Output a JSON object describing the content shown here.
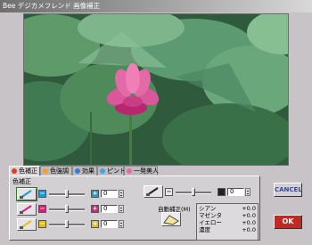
{
  "window": {
    "title": "Bee デジカメフレンド 画像補正"
  },
  "tabs": [
    {
      "label": "色補正",
      "color": "#e23b2a"
    },
    {
      "label": "色強調",
      "color": "#f0a030"
    },
    {
      "label": "効果",
      "color": "#3a7bd5"
    },
    {
      "label": "ピント",
      "color": "#4aa0e0"
    },
    {
      "label": "一発美人",
      "color": "#e86aa0"
    }
  ],
  "panel": {
    "section_label": "色補正",
    "sliders": [
      {
        "name": "cyan",
        "minus": "−",
        "plus": "+",
        "value": "0",
        "minus_color": "#1e9ad6",
        "plus_color": "#1e9ad6"
      },
      {
        "name": "magenta",
        "minus": "−",
        "plus": "+",
        "value": "0",
        "minus_color": "#d81e7a",
        "plus_color": "#d81e7a"
      },
      {
        "name": "yellow",
        "minus": "−",
        "plus": "+",
        "value": "0",
        "minus_color": "#e0c020",
        "plus_color": "#e0c020"
      },
      {
        "name": "density",
        "minus": "−",
        "plus": "",
        "value": "0",
        "minus_color": "#e8e8e8",
        "plus_color": "#222222"
      }
    ],
    "auto_label": "自動補正(M)",
    "readout": [
      {
        "label": "シアン",
        "value": "+0.0"
      },
      {
        "label": "マゼンタ",
        "value": "+0.0"
      },
      {
        "label": "イエロー",
        "value": "+0.0"
      },
      {
        "label": "濃度",
        "value": "+0.0"
      }
    ]
  },
  "buttons": {
    "cancel": "CANCEL",
    "ok": "OK"
  }
}
